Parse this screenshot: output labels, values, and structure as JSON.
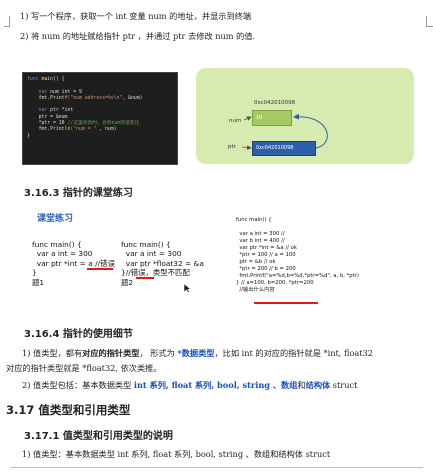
{
  "intro": {
    "line1": "1)  写一个程序，获取一个 int 变量 num 的地址，并显示到终端",
    "line2": "2)  将 num 的地址赋给指针  ptr ，并通过 ptr 去修改 num 的值."
  },
  "code_image": {
    "l1_kw": "func ",
    "l1_fn": "main",
    "l1_rest": "() {",
    "l2_kw": "var ",
    "l2_rest": "num int = 9",
    "l3_pre": "fmt.",
    "l3_fn": "Printf",
    "l3_str": "(\"num address=%v\\n\"",
    "l3_rest": ", &num)",
    "l4_kw": "var ",
    "l4_rest": "ptr *int",
    "l5": "ptr = &num",
    "l6_pre": "*ptr = 10 ",
    "l6_cm": "//这里修改时，会到num的值变化",
    "l7_pre": "fmt.",
    "l7_fn": "Println",
    "l7_str": "(\"num = \"",
    "l7_rest": " , num)",
    "l8": "}"
  },
  "memory_diagram": {
    "num_label": "num",
    "num_addr": "0xc042010098",
    "num_value": "10",
    "ptr_label": "ptr",
    "ptr_value": "0xc042010098"
  },
  "s1": {
    "title": "3.16.3   指针的课堂练习"
  },
  "exercise": {
    "heading": "课堂练习",
    "c1": {
      "l1": "func main() {",
      "l2": "  var a int = 300",
      "l3_pre": "  var ptr *int = a //",
      "l3_err": "错误",
      "l4": "}",
      "caption": "题1"
    },
    "c2": {
      "l1": "func main() {",
      "l2": "  var a int = 300",
      "l3": "  var ptr *float32 = &a",
      "l4_pre": "}//",
      "l4_err": "错误",
      "l4_post": "，类型不匹配",
      "caption": "题2"
    },
    "c3": {
      "l1": "func main() {",
      "l2": "  var a int = 300 //",
      "l3": "  var b int = 400 //",
      "l4": "  var ptr *int = &a // ok",
      "l5": "  *ptr = 100 // a = 100",
      "l6": "  ptr = &b // ok",
      "l7": "  *ptr = 200 // b = 200",
      "l8": "  fmt.Printf(\"a=%d,b=%d,*ptr=%d\", a, b, *ptr)",
      "l9_pre": "} // ",
      "l9_out": "a=100, b=200, *ptr=200",
      "l10": "  //输出什么内容"
    }
  },
  "s2": {
    "title": "3.16.4   指针的使用细节",
    "p1_a": "1)  值类型，都有",
    "p1_b": "对应的指针类型",
    "p1_c": "，  形式为   ",
    "p1_d": "*数据类型",
    "p1_e": "，比如 int 的对应的指针就是 *int, float32",
    "p1_line2": "对应的指针类型就是    *float32, 依次类推。",
    "p2_a": "2)  值类型包括：基本数据类型  ",
    "p2_b": "int 系列, float 系列, bool, string 、数组",
    "p2_c": "和",
    "p2_d": "结构体",
    "p2_e": " struct"
  },
  "s3": {
    "title": "3.17   值类型和引用类型"
  },
  "s4": {
    "title": "3.17.1   值类型和引用类型的说明",
    "p1": "1)  值类型：基本数据类型  int 系列, float 系列, bool, string 、数组和结构体 struct"
  }
}
